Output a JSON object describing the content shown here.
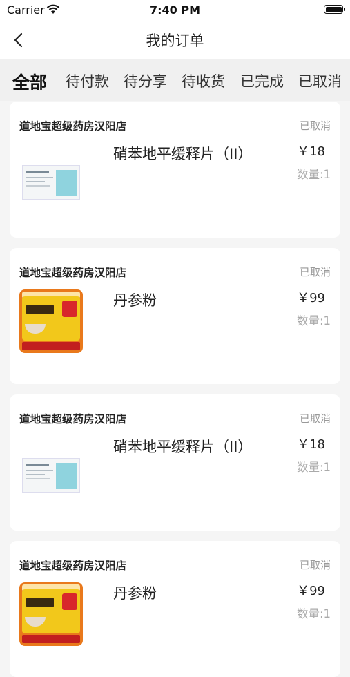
{
  "status_bar": {
    "carrier": "Carrier",
    "time": "7:40 PM"
  },
  "nav": {
    "title": "我的订单"
  },
  "tabs": [
    {
      "label": "全部",
      "active": true
    },
    {
      "label": "待付款",
      "active": false
    },
    {
      "label": "待分享",
      "active": false
    },
    {
      "label": "待收货",
      "active": false
    },
    {
      "label": "已完成",
      "active": false
    },
    {
      "label": "已取消",
      "active": false
    }
  ],
  "orders": [
    {
      "store": "道地宝超级药房汉阳店",
      "status": "已取消",
      "product": "硝苯地平缓释片（II）",
      "price": "￥18",
      "quantity": "数量:1",
      "image": "drug-box"
    },
    {
      "store": "道地宝超级药房汉阳店",
      "status": "已取消",
      "product": "丹参粉",
      "price": "￥99",
      "quantity": "数量:1",
      "image": "danshen-package"
    },
    {
      "store": "道地宝超级药房汉阳店",
      "status": "已取消",
      "product": "硝苯地平缓释片（II）",
      "price": "￥18",
      "quantity": "数量:1",
      "image": "drug-box"
    },
    {
      "store": "道地宝超级药房汉阳店",
      "status": "已取消",
      "product": "丹参粉",
      "price": "￥99",
      "quantity": "数量:1",
      "image": "danshen-package"
    }
  ]
}
